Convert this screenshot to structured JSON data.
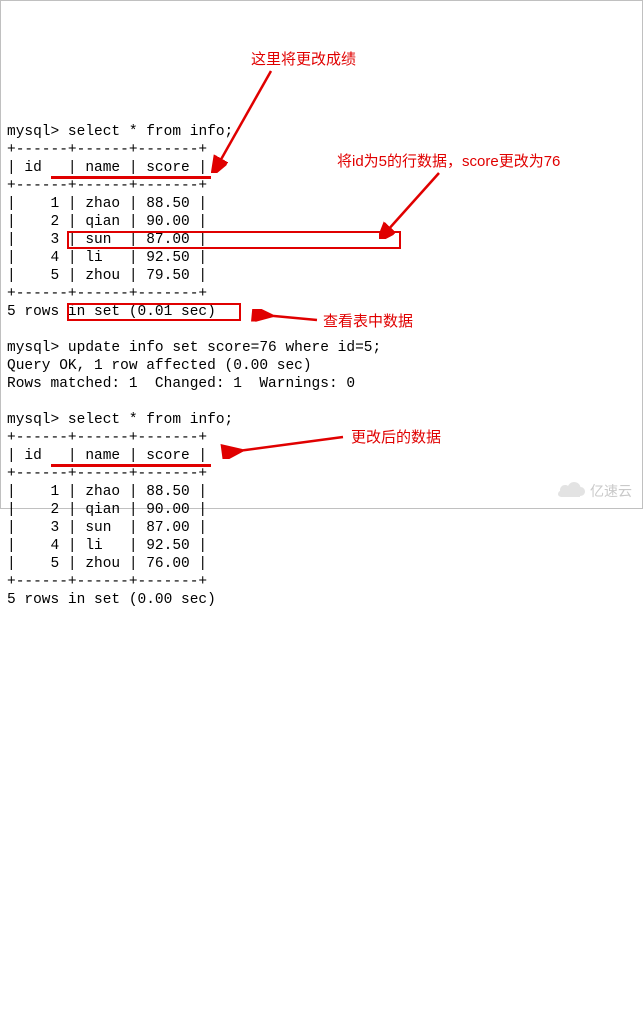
{
  "prompt": "mysql>",
  "queries": {
    "select1": "select * from info;",
    "update": "update info set score=76 where id=5;",
    "select2": "select * from info;"
  },
  "table_border_outer": "+------+------+-------+",
  "table_header": "| id   | name | score |",
  "rows_before": [
    "|    1 | zhao | 88.50 |",
    "|    2 | qian | 90.00 |",
    "|    3 | sun  | 87.00 |",
    "|    4 | li   | 92.50 |",
    "|    5 | zhou | 79.50 |"
  ],
  "rows_after": [
    "|    1 | zhao | 88.50 |",
    "|    2 | qian | 90.00 |",
    "|    3 | sun  | 87.00 |",
    "|    4 | li   | 92.50 |",
    "|    5 | zhou | 76.00 |"
  ],
  "summary1": "5 rows in set (0.01 sec)",
  "update_result1": "Query OK, 1 row affected (0.00 sec)",
  "update_result2": "Rows matched: 1  Changed: 1  Warnings: 0",
  "summary2": "5 rows in set (0.00 sec)",
  "annotations": {
    "a1": "这里将更改成绩",
    "a2": "将id为5的行数据，score更改为76",
    "a3": "查看表中数据",
    "a4": "更改后的数据"
  },
  "watermark": "亿速云",
  "chart_data": {
    "type": "table",
    "title": "info table (before and after UPDATE)",
    "columns": [
      "id",
      "name",
      "score"
    ],
    "before": [
      {
        "id": 1,
        "name": "zhao",
        "score": 88.5
      },
      {
        "id": 2,
        "name": "qian",
        "score": 90.0
      },
      {
        "id": 3,
        "name": "sun",
        "score": 87.0
      },
      {
        "id": 4,
        "name": "li",
        "score": 92.5
      },
      {
        "id": 5,
        "name": "zhou",
        "score": 79.5
      }
    ],
    "after": [
      {
        "id": 1,
        "name": "zhao",
        "score": 88.5
      },
      {
        "id": 2,
        "name": "qian",
        "score": 90.0
      },
      {
        "id": 3,
        "name": "sun",
        "score": 87.0
      },
      {
        "id": 4,
        "name": "li",
        "score": 92.5
      },
      {
        "id": 5,
        "name": "zhou",
        "score": 76.0
      }
    ],
    "update_statement": "UPDATE info SET score=76 WHERE id=5;"
  }
}
